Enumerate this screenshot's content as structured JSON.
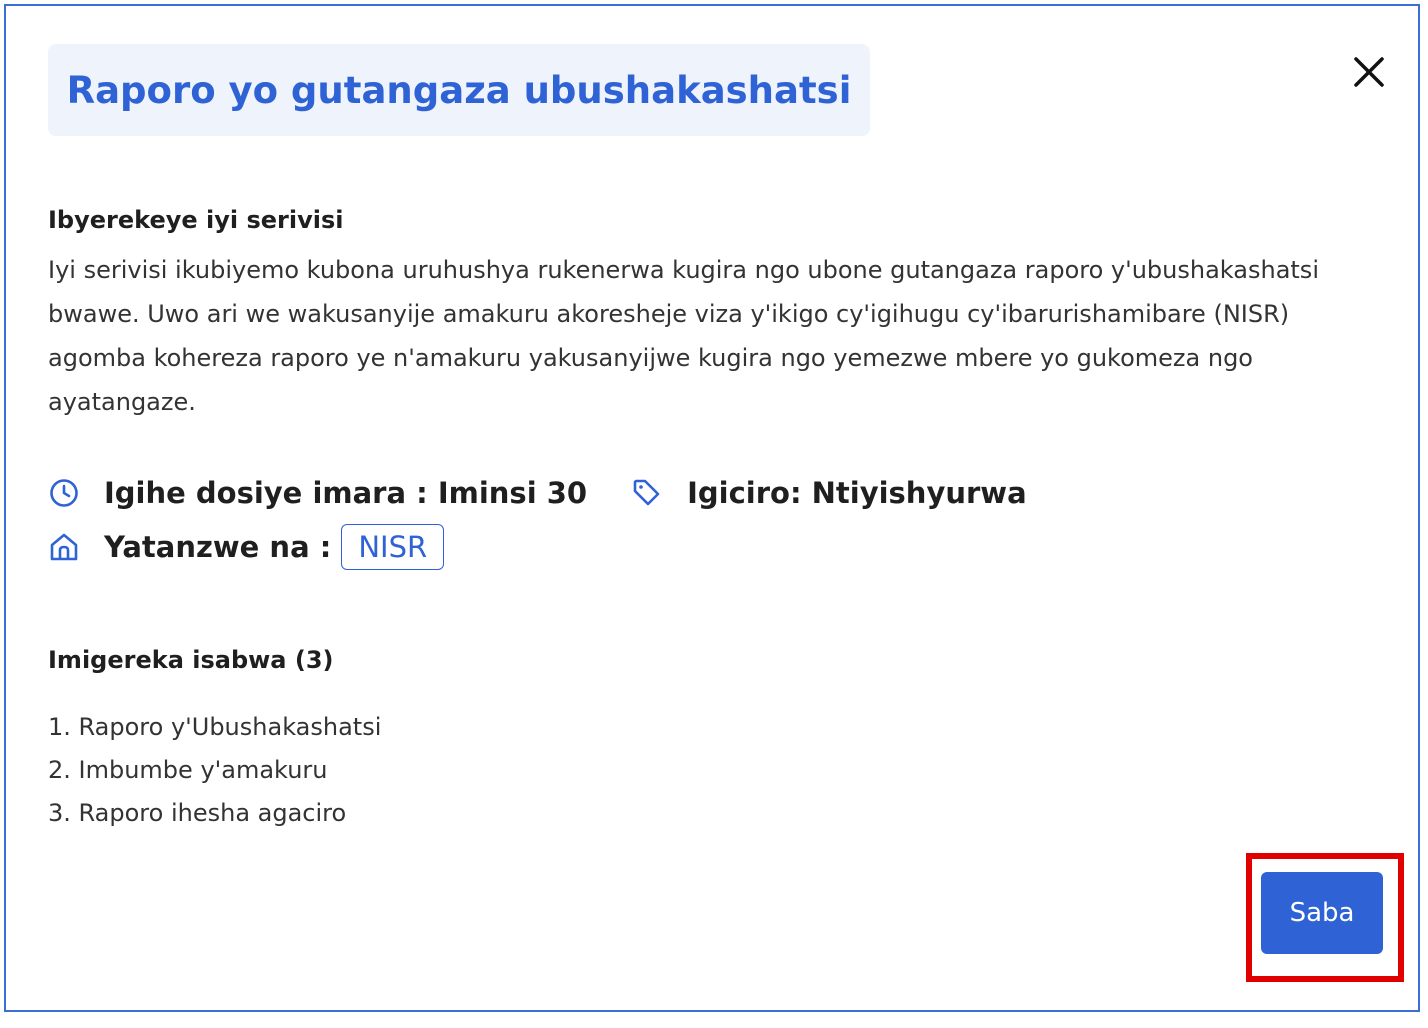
{
  "modal": {
    "title": "Raporo yo gutangaza ubushakashatsi",
    "close_icon": "close-icon"
  },
  "about": {
    "heading": "Ibyerekeye iyi serivisi",
    "body": "Iyi serivisi ikubiyemo kubona uruhushya rukenerwa kugira ngo ubone gutangaza raporo y'ubushakashatsi bwawe. Uwo ari we wakusanyije amakuru akoresheje viza y'ikigo cy'igihugu cy'ibarurishamibare (NISR) agomba kohereza raporo ye n'amakuru yakusanyijwe kugira ngo yemezwe mbere yo gukomeza ngo ayatangaze."
  },
  "info": {
    "duration": {
      "icon": "clock-icon",
      "text": "Igihe dosiye imara : Iminsi 30"
    },
    "price": {
      "icon": "tag-icon",
      "text": "Igiciro: Ntiyishyurwa"
    },
    "provider": {
      "icon": "building-icon",
      "label": "Yatanzwe na :",
      "badge": "NISR"
    }
  },
  "requirements": {
    "heading": "Imigereka isabwa (3)",
    "items": [
      "1. Raporo y'Ubushakashatsi",
      "2. Imbumbe y'amakuru",
      "3. Raporo ihesha agaciro"
    ]
  },
  "actions": {
    "apply_label": "Saba",
    "highlight_color": "#e00000"
  },
  "colors": {
    "accent": "#2f62d4",
    "title_bg": "#eef3fc",
    "modal_border": "#3b6fd6"
  }
}
